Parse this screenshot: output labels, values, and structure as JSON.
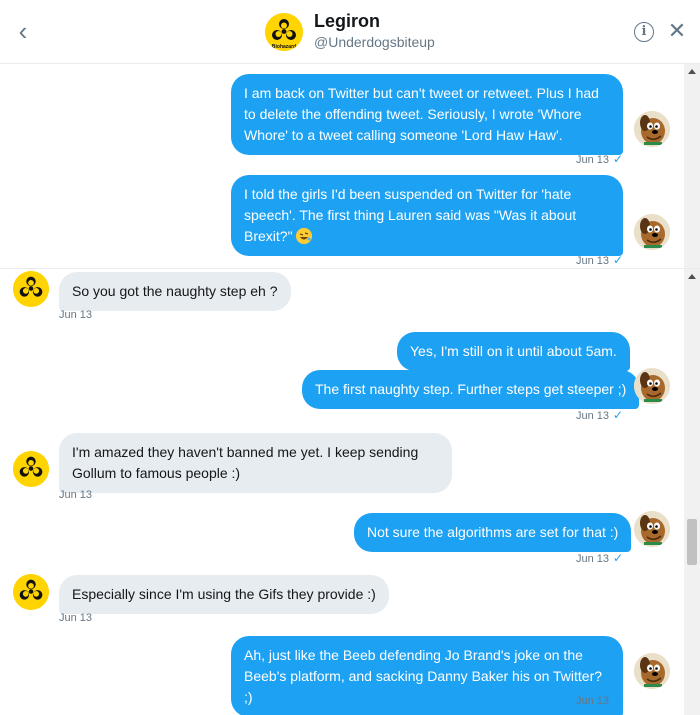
{
  "header": {
    "name": "Legiron",
    "handle": "@Underdogsbiteup",
    "back_icon": "chevron-left-icon",
    "info_icon": "info-icon",
    "close_icon": "close-icon",
    "avatar_text": "Biohazard"
  },
  "colors": {
    "sent_bubble": "#1da1f2",
    "received_bubble": "#e6ecf0",
    "timestamp": "#657786",
    "avatar_yellow": "#ffd400"
  },
  "messages_top": [
    {
      "direction": "sent",
      "text": "I am back on Twitter but can't tweet or retweet. Plus I had to delete the offending tweet. Seriously, I wrote 'Whore Whore' to a tweet calling someone 'Lord Haw Haw'.",
      "time": "Jun 13",
      "read_icon": "check-icon"
    },
    {
      "direction": "sent",
      "text": "I told the girls I'd been suspended on Twitter for 'hate speech'. The first thing Lauren said was \"Was it about Brexit?\"",
      "emoji": "rolling-on-floor-laughing-emoji",
      "time": "Jun 13",
      "read_icon": "check-icon"
    }
  ],
  "messages_bottom": [
    {
      "direction": "received",
      "text": "So you got the naughty step eh ?",
      "time": "Jun 13"
    },
    {
      "direction": "sent",
      "text": "Yes, I'm still on it until about 5am."
    },
    {
      "direction": "sent",
      "text": "The first naughty step. Further steps get steeper ;)",
      "time": "Jun 13"
    },
    {
      "direction": "received",
      "text": "I'm amazed they haven't banned me yet. I keep sending Gollum to famous people :)",
      "time": "Jun 13"
    },
    {
      "direction": "sent",
      "text": "Not sure the algorithms are set for that :)",
      "time": "Jun 13"
    },
    {
      "direction": "received",
      "text": "Especially since I'm using the Gifs they provide :)",
      "time": "Jun 13"
    },
    {
      "direction": "sent",
      "text": "Ah, just like the Beeb defending Jo Brand's joke on the Beeb's platform, and sacking Danny Baker his on Twitter? ;)",
      "time": "Jun 13"
    }
  ]
}
